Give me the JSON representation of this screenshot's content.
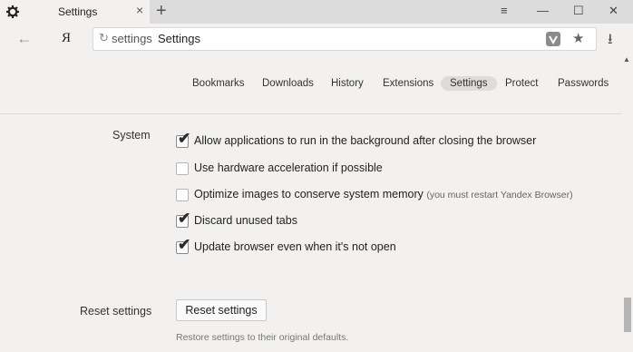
{
  "tab": {
    "title": "Settings",
    "close": "×",
    "new_tab": "+"
  },
  "window_controls": {
    "menu": "≡",
    "minimize": "—",
    "maximize": "☐",
    "close": "✕"
  },
  "toolbar": {
    "back": "←",
    "yandex_logo": "Я",
    "address_prefix": "settings",
    "address_text": "Settings",
    "bookmark_star": "★",
    "downloads": "⭳"
  },
  "settings_nav": [
    {
      "label": "Bookmarks",
      "active": false
    },
    {
      "label": "Downloads",
      "active": false
    },
    {
      "label": "History",
      "active": false
    },
    {
      "label": "Extensions",
      "active": false
    },
    {
      "label": "Settings",
      "active": true
    },
    {
      "label": "Protect",
      "active": false
    },
    {
      "label": "Passwords",
      "active": false
    }
  ],
  "system": {
    "label": "System",
    "options": [
      {
        "label": "Allow applications to run in the background after closing the browser",
        "note": "",
        "checked": true
      },
      {
        "label": "Use hardware acceleration if possible",
        "note": "",
        "checked": false
      },
      {
        "label": "Optimize images to conserve system memory",
        "note": "(you must restart Yandex Browser)",
        "checked": false
      },
      {
        "label": "Discard unused tabs",
        "note": "",
        "checked": true
      },
      {
        "label": "Update browser even when it's not open",
        "note": "",
        "checked": true
      }
    ]
  },
  "reset": {
    "label": "Reset settings",
    "button": "Reset settings",
    "description": "Restore settings to their original defaults."
  },
  "icons": {
    "tab": "gear-icon",
    "reload": "reload-icon",
    "address_badge": "shield-icon",
    "bookmark": "star-icon",
    "downloads": "download-icon",
    "checkbox_mark": "✔"
  }
}
